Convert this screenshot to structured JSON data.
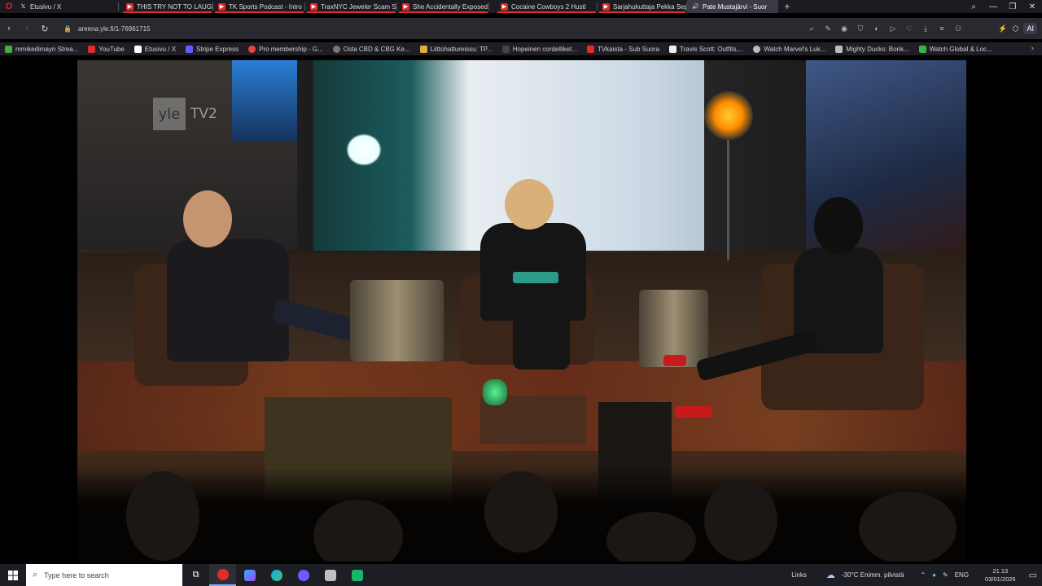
{
  "tabs": [
    {
      "label": "Etusivu / X",
      "icon": "x-icon",
      "color": "#ffffff"
    },
    {
      "label": "THIS TRY NOT TO LAUGH",
      "icon": "youtube-icon",
      "color": "#e22b2b"
    },
    {
      "label": "TK Sports Podcast - Intro",
      "icon": "youtube-icon",
      "color": "#e22b2b"
    },
    {
      "label": "TraxNYC Jeweler Scam Sit",
      "icon": "youtube-icon",
      "color": "#e22b2b"
    },
    {
      "label": "She Accidentally Exposed",
      "icon": "youtube-icon",
      "color": "#e22b2b"
    },
    {
      "label": "Cocaine Cowboys 2 Hustl",
      "icon": "youtube-icon",
      "color": "#e22b2b"
    },
    {
      "label": "Sarjahukuttaja Pekka Sepp",
      "icon": "youtube-icon",
      "color": "#e22b2b"
    },
    {
      "label": "Pate Mustajärvi - Suor",
      "icon": "speaker-icon",
      "color": "#9bb8ff",
      "active": true
    }
  ],
  "address": {
    "url": "areena.yle.fi/1-76961715"
  },
  "bookmarks": [
    {
      "label": "mmikedimayn Strea...",
      "color": "#3cb043"
    },
    {
      "label": "YouTube",
      "color": "#e22b2b"
    },
    {
      "label": "Etusivu / X",
      "color": "#ffffff"
    },
    {
      "label": "Stripe Express",
      "color": "#635bff"
    },
    {
      "label": "Pro membership - G...",
      "color": "#e84343"
    },
    {
      "label": "Osta CBD & CBG Ke...",
      "color": "#777777"
    },
    {
      "label": "Liittohattureissu: TP...",
      "color": "#d8b13a"
    },
    {
      "label": "Hopeinen cordelliket...",
      "color": "#444444"
    },
    {
      "label": "TVkaista - Sub Suora",
      "color": "#e22b2b"
    },
    {
      "label": "Travis Scott: Outfits,...",
      "color": "#eeeeee"
    },
    {
      "label": "Watch Marvel's Luk...",
      "color": "#bbbbbb"
    },
    {
      "label": "Mighty Ducks: Bonk...",
      "color": "#bbbbbb"
    },
    {
      "label": "Watch Global & Loc...",
      "color": "#3cb043"
    }
  ],
  "video": {
    "logo_text": "yle",
    "channel": "TV2"
  },
  "taskbar": {
    "search_placeholder": "Type here to search",
    "links_label": "Links",
    "weather": "-30°C  Enimm. pilvistä",
    "lang": "ENG",
    "time": "21.13",
    "date": "03/01/2026"
  },
  "addr_right": {
    "ai_label": "AI"
  }
}
